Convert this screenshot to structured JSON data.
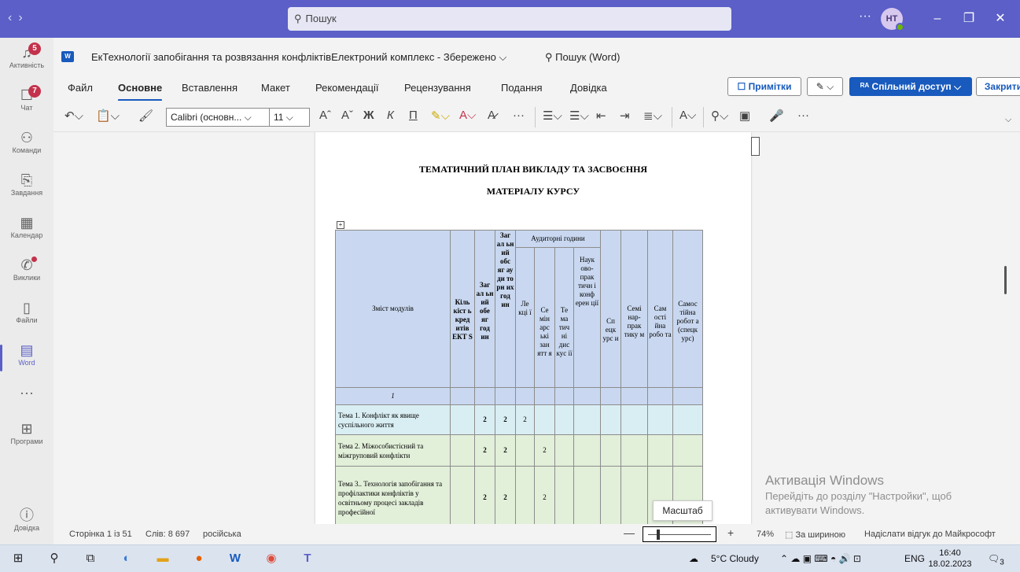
{
  "teams": {
    "search_placeholder": "Пошук",
    "more": "···",
    "avatar_initials": "HT",
    "rail": [
      {
        "label": "Активність",
        "icon": "bell-icon",
        "glyph": "🔔",
        "badge": "5"
      },
      {
        "label": "Чат",
        "icon": "chat-icon",
        "glyph": "💬",
        "badge": "7"
      },
      {
        "label": "Команди",
        "icon": "teams-icon",
        "glyph": "👥"
      },
      {
        "label": "Завдання",
        "icon": "tasks-icon",
        "glyph": "🗒"
      },
      {
        "label": "Календар",
        "icon": "calendar-icon",
        "glyph": "📅"
      },
      {
        "label": "Виклики",
        "icon": "phone-icon",
        "glyph": "📞"
      },
      {
        "label": "Файли",
        "icon": "files-icon",
        "glyph": "🗋"
      },
      {
        "label": "Word",
        "icon": "word-icon",
        "glyph": "W"
      },
      {
        "label": "",
        "icon": "more-apps-icon",
        "glyph": "···"
      },
      {
        "label": "Програми",
        "icon": "apps-icon",
        "glyph": "⊞"
      },
      {
        "label": "Довідка",
        "icon": "help-icon",
        "glyph": "?"
      }
    ]
  },
  "word": {
    "doc_title": "ЕкТехнології запобігання та розвязання конфліктівЕлектроний комплекс - Збережено ⌵",
    "search": "Пошук (Word)",
    "tabs": [
      "Файл",
      "Основне",
      "Вставлення",
      "Макет",
      "Рекомендації",
      "Рецензування",
      "Подання",
      "Довідка"
    ],
    "btn_notes": "Примітки",
    "btn_share": "Спільний доступ",
    "btn_close": "Закрити",
    "font_name": "Calibri (основн... ⌵",
    "font_size": "11 ⌵",
    "ribbon_bold": "Ж",
    "ribbon_italic": "К",
    "ribbon_underline": "П"
  },
  "document": {
    "heading1": "ТЕМАТИЧНИЙ ПЛАН ВИКЛАДУ ТА ЗАСВОЄННЯ",
    "heading2": "МАТЕРІАЛУ КУРСУ",
    "table": {
      "col_content": "Зміст модулів",
      "col_ects": "Кіль кіст ь кред итів ЕКТ S",
      "col_total": "Заг ал ьн ий обе яг год ин",
      "col_total_aud": "Заг ал ьн ий обс яг ау ди то рн их год ин",
      "col_aud_group": "Аудиторні години",
      "col_lectures": "Ле кці ї",
      "col_seminars": "Се мін арс ькі зан ятт я",
      "col_thematic": "Те ма тич ні дис кус ії",
      "col_conference": "Наук ово- прак тичн і конф ерен ції",
      "col_special": "Сп ецк урс и",
      "col_practicum": "Семі нар- прак тику м",
      "col_selfwork": "Сам ості йна робо та",
      "col_indep": "Самос тійна робот а (спецк урс)",
      "module_row": "1",
      "rows": [
        {
          "topic": "Тема 1. Конфлікт як явище суспільного життя",
          "total": "2",
          "aud": "2",
          "lectures": "2",
          "seminars": ""
        },
        {
          "topic": "Тема 2. Міжособистісний та міжгруповий конфлікти",
          "total": "2",
          "aud": "2",
          "lectures": "",
          "seminars": "2"
        },
        {
          "topic": "Тема 3.. Технологія запобігання та профілактики конфліктів у освітньому процесі закладів професійної",
          "total": "2",
          "aud": "2",
          "lectures": "",
          "seminars": "2"
        }
      ]
    }
  },
  "activation": {
    "title": "Активація Windows",
    "line1": "Перейдіть до розділу \"Настройки\", щоб",
    "line2": "активувати Windows."
  },
  "tooltip": "Масштаб",
  "status": {
    "page": "Сторінка 1 із 51",
    "words": "Слів: 8 697",
    "lang": "російська",
    "zoom_minus": "—",
    "zoom_plus": "+",
    "zoom": "74%",
    "fit_width": "За шириною",
    "feedback": "Надіслати відгук до Майкрософт",
    "zoom_value": 0.14
  },
  "taskbar": {
    "weather": "5°C  Cloudy",
    "lang": "ENG",
    "time": "16:40",
    "date": "18.02.2023",
    "notif": "3"
  }
}
